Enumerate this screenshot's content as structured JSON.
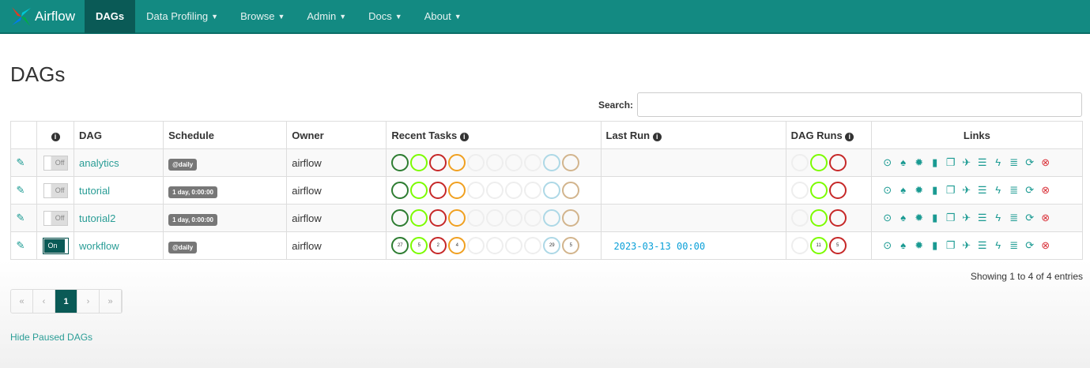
{
  "nav": {
    "brand": "Airflow",
    "items": [
      {
        "label": "DAGs",
        "dropdown": false
      },
      {
        "label": "Data Profiling",
        "dropdown": true
      },
      {
        "label": "Browse",
        "dropdown": true
      },
      {
        "label": "Admin",
        "dropdown": true
      },
      {
        "label": "Docs",
        "dropdown": true
      },
      {
        "label": "About",
        "dropdown": true
      }
    ]
  },
  "page_title": "DAGs",
  "search": {
    "label": "Search:",
    "value": ""
  },
  "columns": [
    "",
    "",
    "DAG",
    "Schedule",
    "Owner",
    "Recent Tasks",
    "Last Run",
    "DAG Runs",
    "Links"
  ],
  "rows": [
    {
      "dag": "analytics",
      "toggle": "Off",
      "schedule": "@daily",
      "owner": "airflow",
      "recent_tasks": [
        "",
        "",
        "",
        "",
        "",
        "",
        "",
        "",
        "",
        ""
      ],
      "last_run": "",
      "dag_runs": [
        "",
        "",
        ""
      ]
    },
    {
      "dag": "tutorial",
      "toggle": "Off",
      "schedule": "1 day, 0:00:00",
      "owner": "airflow",
      "recent_tasks": [
        "",
        "",
        "",
        "",
        "",
        "",
        "",
        "",
        "",
        ""
      ],
      "last_run": "",
      "dag_runs": [
        "",
        "",
        ""
      ]
    },
    {
      "dag": "tutorial2",
      "toggle": "Off",
      "schedule": "1 day, 0:00:00",
      "owner": "airflow",
      "recent_tasks": [
        "",
        "",
        "",
        "",
        "",
        "",
        "",
        "",
        "",
        ""
      ],
      "last_run": "",
      "dag_runs": [
        "",
        "",
        ""
      ]
    },
    {
      "dag": "workflow",
      "toggle": "On",
      "schedule": "@daily",
      "owner": "airflow",
      "recent_tasks": [
        "27",
        "5",
        "2",
        "4",
        "",
        "",
        "",
        "",
        "29",
        "5"
      ],
      "last_run": "2023-03-13 00:00",
      "dag_runs": [
        "",
        "11",
        "5"
      ]
    }
  ],
  "task_colors": [
    "#2e7d32",
    "#7cfc00",
    "#c62828",
    "#f0a020",
    "#eeeeee",
    "#eeeeee",
    "#eeeeee",
    "#eeeeee",
    "#add8e6",
    "#d2b48c"
  ],
  "run_colors": [
    "#eeeeee",
    "#7cfc00",
    "#c62828"
  ],
  "link_icons": [
    "trigger-icon",
    "tree-icon",
    "graph-icon",
    "duration-icon",
    "tries-icon",
    "landing-icon",
    "gantt-icon",
    "code-icon",
    "logs-icon",
    "refresh-icon",
    "delete-icon"
  ],
  "footer": {
    "showing": "Showing 1 to 4 of 4 entries",
    "pager": [
      "«",
      "‹",
      "1",
      "›",
      "»"
    ],
    "hide_paused": "Hide Paused DAGs"
  }
}
